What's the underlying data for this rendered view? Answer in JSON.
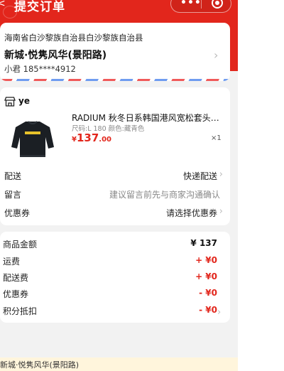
{
  "header": {
    "back_icon": "<",
    "title": "提交订单",
    "more_icon": "•••",
    "colors": {
      "brand_red": "#e2261c"
    }
  },
  "address": {
    "region": "海南省白沙黎族自治县白沙黎族自治县",
    "street": "新城·悦隽风华(景阳路)",
    "contact": "小君  185****4912",
    "chevron": "›"
  },
  "order": {
    "store_name": "ye",
    "product": {
      "title": "RADIUM 秋冬日系韩国港风宽松套头卫衣",
      "spec": "尺码:L 180  颜色:藏青色",
      "price_symbol": "¥",
      "price_int": "137",
      "price_dec": ".00",
      "quantity": "×1"
    },
    "rows": [
      {
        "label": "配送",
        "value": "快递配送"
      },
      {
        "label": "留言",
        "value": "建议留言前先与商家沟通确认"
      },
      {
        "label": "优惠券",
        "value": "请选择优惠券"
      }
    ]
  },
  "summary": {
    "rows": [
      {
        "label": "商品金额",
        "value": "¥ 137"
      },
      {
        "label": "运费",
        "value": "+ ¥0"
      },
      {
        "label": "配送费",
        "value": "+ ¥0"
      },
      {
        "label": "优惠券",
        "value": "- ¥0"
      },
      {
        "label": "积分抵扣",
        "value": "- ¥0"
      }
    ]
  },
  "bottom_bar": {
    "address_text": "新城·悦隽风华(景阳路)"
  }
}
